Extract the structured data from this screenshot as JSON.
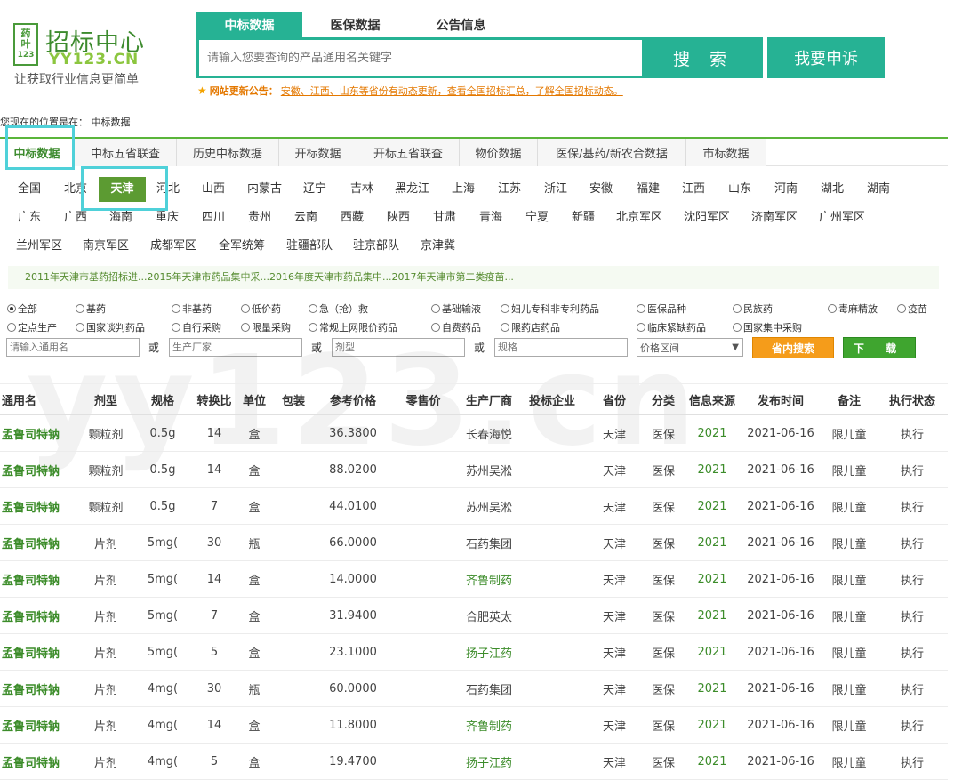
{
  "logo": {
    "box": "药\n叶\n123",
    "title": "招标中心",
    "url": "YY123.CN",
    "slogan": "让获取行业信息更简单"
  },
  "search": {
    "tabs": [
      "中标数据",
      "医保数据",
      "公告信息"
    ],
    "placeholder": "请输入您要查询的产品通用名关键字",
    "button": "搜 索",
    "complain": "我要申诉"
  },
  "notice": {
    "label": "网站更新公告：",
    "text": "安徽、江西、山东等省份有动态更新，查看全国招标汇总，了解全国招标动态。"
  },
  "breadcrumb": "您现在的位置是在： 中标数据",
  "main_tabs": [
    "中标数据",
    "中标五省联查",
    "历史中标数据",
    "开标数据",
    "开标五省联查",
    "物价数据",
    "医保/基药/新农合数据",
    "市标数据"
  ],
  "provinces": [
    "全国",
    "北京",
    "天津",
    "河北",
    "山西",
    "内蒙古",
    "辽宁",
    "吉林",
    "黑龙江",
    "上海",
    "江苏",
    "浙江",
    "安徽",
    "福建",
    "江西",
    "山东",
    "河南",
    "湖北",
    "湖南",
    "广东",
    "广西",
    "海南",
    "重庆",
    "四川",
    "贵州",
    "云南",
    "西藏",
    "陕西",
    "甘肃",
    "青海",
    "宁夏",
    "新疆",
    "北京军区",
    "沈阳军区",
    "济南军区",
    "广州军区",
    "兰州军区",
    "南京军区",
    "成都军区",
    "全军统筹",
    "驻疆部队",
    "驻京部队",
    "京津冀"
  ],
  "links": "2011年天津市基药招标进...2015年天津市药品集中采...2016年度天津市药品集中...2017年天津市第二类疫苗...",
  "radios": [
    "全部",
    "基药",
    "非基药",
    "低价药",
    "急（抢）救",
    "基础输液",
    "妇儿专科非专利药品",
    "医保品种",
    "民族药",
    "毒麻精放",
    "疫苗",
    "定点生产",
    "国家谈判药品",
    "自行采购",
    "限量采购",
    "常规上网限价药品",
    "自费药品",
    "限药店药品",
    "临床紧缺药品",
    "国家集中采购"
  ],
  "filters": {
    "name_ph": "请输入通用名",
    "or": "或",
    "mfr_ph": "生产厂家",
    "form_ph": "剂型",
    "spec_ph": "规格",
    "price": "价格区间",
    "search_btn": "省内搜索",
    "download_btn": "下 载"
  },
  "watermark": "yy123.cn",
  "table": {
    "headers": [
      "通用名",
      "剂型",
      "规格",
      "转换比",
      "单位",
      "包装",
      "参考价格",
      "零售价",
      "生产厂商",
      "投标企业",
      "省份",
      "分类",
      "信息来源",
      "发布时间",
      "备注",
      "执行状态"
    ],
    "rows": [
      {
        "name": "孟鲁司特钠",
        "form": "颗粒剂",
        "spec": "0.5g",
        "ratio": "14",
        "unit": "盒",
        "pack": "",
        "price": "36.3800",
        "retail": "",
        "mfr": "长春海悦",
        "mfr_link": false,
        "bidder": "",
        "prov": "天津",
        "cat": "医保",
        "src": "2021",
        "date": "2021-06-16",
        "note": "限儿童",
        "status": "执行"
      },
      {
        "name": "孟鲁司特钠",
        "form": "颗粒剂",
        "spec": "0.5g",
        "ratio": "14",
        "unit": "盒",
        "pack": "",
        "price": "88.0200",
        "retail": "",
        "mfr": "苏州吴淞",
        "mfr_link": false,
        "bidder": "",
        "prov": "天津",
        "cat": "医保",
        "src": "2021",
        "date": "2021-06-16",
        "note": "限儿童",
        "status": "执行"
      },
      {
        "name": "孟鲁司特钠",
        "form": "颗粒剂",
        "spec": "0.5g",
        "ratio": "7",
        "unit": "盒",
        "pack": "",
        "price": "44.0100",
        "retail": "",
        "mfr": "苏州吴淞",
        "mfr_link": false,
        "bidder": "",
        "prov": "天津",
        "cat": "医保",
        "src": "2021",
        "date": "2021-06-16",
        "note": "限儿童",
        "status": "执行"
      },
      {
        "name": "孟鲁司特钠",
        "form": "片剂",
        "spec": "5mg(",
        "ratio": "30",
        "unit": "瓶",
        "pack": "",
        "price": "66.0000",
        "retail": "",
        "mfr": "石药集团",
        "mfr_link": false,
        "bidder": "",
        "prov": "天津",
        "cat": "医保",
        "src": "2021",
        "date": "2021-06-16",
        "note": "限儿童",
        "status": "执行"
      },
      {
        "name": "孟鲁司特钠",
        "form": "片剂",
        "spec": "5mg(",
        "ratio": "14",
        "unit": "盒",
        "pack": "",
        "price": "14.0000",
        "retail": "",
        "mfr": "齐鲁制药",
        "mfr_link": true,
        "bidder": "",
        "prov": "天津",
        "cat": "医保",
        "src": "2021",
        "date": "2021-06-16",
        "note": "限儿童",
        "status": "执行"
      },
      {
        "name": "孟鲁司特钠",
        "form": "片剂",
        "spec": "5mg(",
        "ratio": "7",
        "unit": "盒",
        "pack": "",
        "price": "31.9400",
        "retail": "",
        "mfr": "合肥英太",
        "mfr_link": false,
        "bidder": "",
        "prov": "天津",
        "cat": "医保",
        "src": "2021",
        "date": "2021-06-16",
        "note": "限儿童",
        "status": "执行"
      },
      {
        "name": "孟鲁司特钠",
        "form": "片剂",
        "spec": "5mg(",
        "ratio": "5",
        "unit": "盒",
        "pack": "",
        "price": "23.1000",
        "retail": "",
        "mfr": "扬子江药",
        "mfr_link": true,
        "bidder": "",
        "prov": "天津",
        "cat": "医保",
        "src": "2021",
        "date": "2021-06-16",
        "note": "限儿童",
        "status": "执行"
      },
      {
        "name": "孟鲁司特钠",
        "form": "片剂",
        "spec": "4mg(",
        "ratio": "30",
        "unit": "瓶",
        "pack": "",
        "price": "60.0000",
        "retail": "",
        "mfr": "石药集团",
        "mfr_link": false,
        "bidder": "",
        "prov": "天津",
        "cat": "医保",
        "src": "2021",
        "date": "2021-06-16",
        "note": "限儿童",
        "status": "执行"
      },
      {
        "name": "孟鲁司特钠",
        "form": "片剂",
        "spec": "4mg(",
        "ratio": "14",
        "unit": "盒",
        "pack": "",
        "price": "11.8000",
        "retail": "",
        "mfr": "齐鲁制药",
        "mfr_link": true,
        "bidder": "",
        "prov": "天津",
        "cat": "医保",
        "src": "2021",
        "date": "2021-06-16",
        "note": "限儿童",
        "status": "执行"
      },
      {
        "name": "孟鲁司特钠",
        "form": "片剂",
        "spec": "4mg(",
        "ratio": "5",
        "unit": "盒",
        "pack": "",
        "price": "19.4700",
        "retail": "",
        "mfr": "扬子江药",
        "mfr_link": true,
        "bidder": "",
        "prov": "天津",
        "cat": "医保",
        "src": "2021",
        "date": "2021-06-16",
        "note": "限儿童",
        "status": "执行"
      }
    ]
  },
  "colors": {
    "accent": "#26b294",
    "brand_green": "#3d8b2e",
    "active_province": "#5c9b32",
    "highlight": "#4fd1d9"
  }
}
